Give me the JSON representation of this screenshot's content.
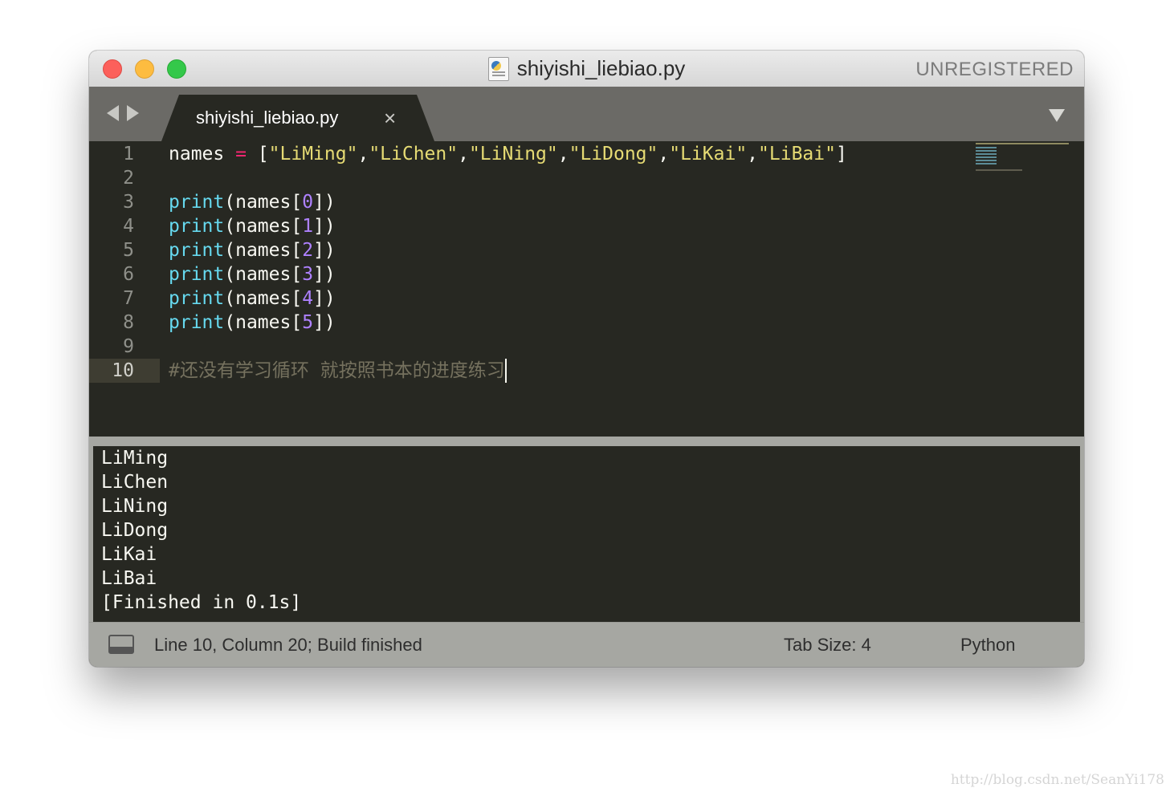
{
  "window": {
    "title": "shiyishi_liebiao.py",
    "unregistered_label": "UNREGISTERED",
    "file_icon": "python-file-icon"
  },
  "tabs": [
    {
      "label": "shiyishi_liebiao.py",
      "close": "×"
    }
  ],
  "editor": {
    "lines": [
      {
        "number": "1",
        "tokens": [
          {
            "t": "names",
            "c": "t-var"
          },
          {
            "t": " ",
            "c": ""
          },
          {
            "t": "=",
            "c": "t-op"
          },
          {
            "t": " [",
            "c": "t-punct"
          },
          {
            "t": "\"LiMing\"",
            "c": "t-str"
          },
          {
            "t": ",",
            "c": "t-punct"
          },
          {
            "t": "\"LiChen\"",
            "c": "t-str"
          },
          {
            "t": ",",
            "c": "t-punct"
          },
          {
            "t": "\"LiNing\"",
            "c": "t-str"
          },
          {
            "t": ",",
            "c": "t-punct"
          },
          {
            "t": "\"LiDong\"",
            "c": "t-str"
          },
          {
            "t": ",",
            "c": "t-punct"
          },
          {
            "t": "\"LiKai\"",
            "c": "t-str"
          },
          {
            "t": ",",
            "c": "t-punct"
          },
          {
            "t": "\"LiBai\"",
            "c": "t-str"
          },
          {
            "t": "]",
            "c": "t-punct"
          }
        ]
      },
      {
        "number": "2",
        "tokens": []
      },
      {
        "number": "3",
        "tokens": [
          {
            "t": "print",
            "c": "t-fn"
          },
          {
            "t": "(names[",
            "c": "t-var"
          },
          {
            "t": "0",
            "c": "t-num"
          },
          {
            "t": "])",
            "c": "t-var"
          }
        ]
      },
      {
        "number": "4",
        "tokens": [
          {
            "t": "print",
            "c": "t-fn"
          },
          {
            "t": "(names[",
            "c": "t-var"
          },
          {
            "t": "1",
            "c": "t-num"
          },
          {
            "t": "])",
            "c": "t-var"
          }
        ]
      },
      {
        "number": "5",
        "tokens": [
          {
            "t": "print",
            "c": "t-fn"
          },
          {
            "t": "(names[",
            "c": "t-var"
          },
          {
            "t": "2",
            "c": "t-num"
          },
          {
            "t": "])",
            "c": "t-var"
          }
        ]
      },
      {
        "number": "6",
        "tokens": [
          {
            "t": "print",
            "c": "t-fn"
          },
          {
            "t": "(names[",
            "c": "t-var"
          },
          {
            "t": "3",
            "c": "t-num"
          },
          {
            "t": "])",
            "c": "t-var"
          }
        ]
      },
      {
        "number": "7",
        "tokens": [
          {
            "t": "print",
            "c": "t-fn"
          },
          {
            "t": "(names[",
            "c": "t-var"
          },
          {
            "t": "4",
            "c": "t-num"
          },
          {
            "t": "])",
            "c": "t-var"
          }
        ]
      },
      {
        "number": "8",
        "tokens": [
          {
            "t": "print",
            "c": "t-fn"
          },
          {
            "t": "(names[",
            "c": "t-var"
          },
          {
            "t": "5",
            "c": "t-num"
          },
          {
            "t": "])",
            "c": "t-var"
          }
        ]
      },
      {
        "number": "9",
        "tokens": []
      },
      {
        "number": "10",
        "tokens": [
          {
            "t": "#还没有学习循环 就按照书本的进度练习",
            "c": "t-comment"
          }
        ],
        "current": true
      }
    ]
  },
  "output": {
    "lines": [
      "LiMing",
      "LiChen",
      "LiNing",
      "LiDong",
      "LiKai",
      "LiBai",
      "[Finished in 0.1s]"
    ]
  },
  "status": {
    "position": "Line 10, Column 20; Build finished",
    "tab_size": "Tab Size: 4",
    "syntax": "Python"
  },
  "watermark": "http://blog.csdn.net/SeanYi178",
  "colors": {
    "background": "#272822",
    "string": "#e6db74",
    "function": "#66d9ef",
    "number": "#ae81ff",
    "operator": "#f92672",
    "comment": "#75715e"
  }
}
